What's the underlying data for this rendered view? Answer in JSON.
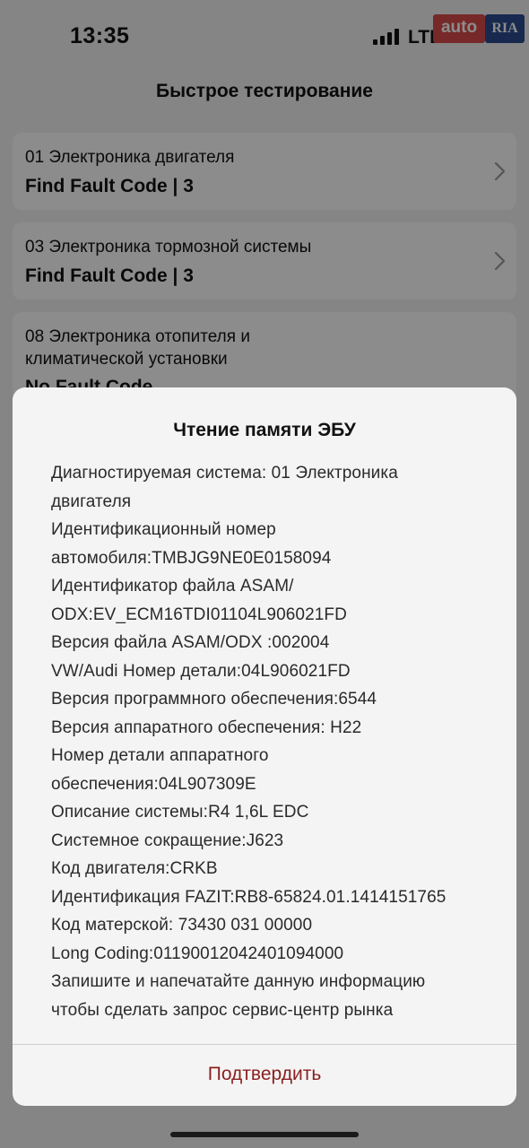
{
  "status_bar": {
    "time": "13:35",
    "network": "LTE",
    "icons": [
      "signal-icon",
      "battery-icon"
    ]
  },
  "watermark": {
    "left": "auto",
    "right": "RIA"
  },
  "header": {
    "title": "Быстрое тестирование"
  },
  "systems": [
    {
      "system": "01 Электроника двигателя",
      "result": "Find Fault Code | 3"
    },
    {
      "system": "03 Электроника тормозной системы",
      "result": "Find Fault Code | 3"
    },
    {
      "system_lines": [
        "08 Электроника отопителя и",
        "климатической установки"
      ],
      "result": "No Fault Code"
    }
  ],
  "dialog": {
    "title": "Чтение памяти ЭБУ",
    "lines": [
      "Диагностируемая система: 01 Электроника",
      "двигателя",
      "Идентификационный номер",
      "автомобиля:TMBJG9NE0E0158094",
      "Идентификатор файла ASAM/",
      "ODX:EV_ECM16TDI01104L906021FD",
      "Версия файла ASAM/ODX :002004",
      "VW/Audi Номер детали:04L906021FD",
      "Версия программного обеспечения:6544",
      "Версия аппаратного обеспечения: H22",
      "Номер детали аппаратного",
      "обеспечения:04L907309E",
      "Описание системы:R4 1,6L EDC",
      "Системное сокращение:J623",
      "Код двигателя:CRKB",
      "Идентификация FAZIT:RB8-65824.01.1414151765",
      "Код матерской: 73430  031  00000",
      "Long Coding:0119001204240109400​0",
      "Запишите и напечатайте данную информацию",
      "чтобы сделать запрос сервис-центр рынка"
    ],
    "confirm_label": "Подтвердить"
  },
  "colors": {
    "confirm_text": "#8a1f1f",
    "overlay": "rgba(0,0,0,0.45)",
    "watermark_red": "#d94a4a",
    "watermark_blue": "#2b4b8f"
  }
}
